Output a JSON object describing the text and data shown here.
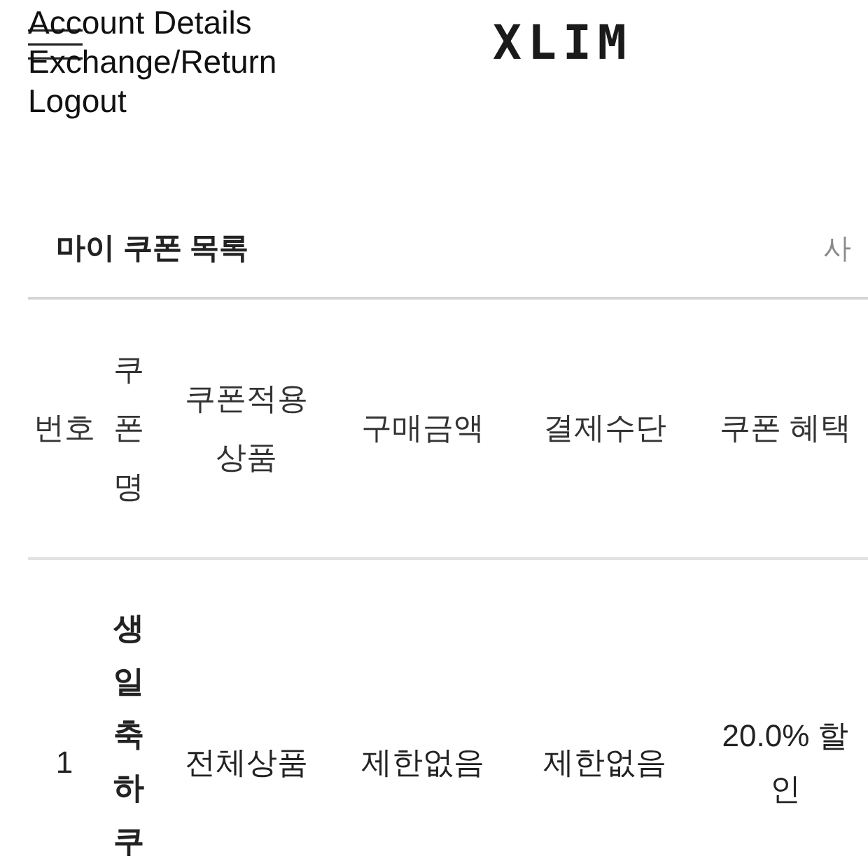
{
  "nav": {
    "links": [
      "Account Details",
      "Exchange/Return",
      "Logout"
    ]
  },
  "logo": {
    "text": "XLIM"
  },
  "coupons": {
    "title": "마이 쿠폰 목록",
    "side_text": "사",
    "table": {
      "columns": [
        "번호",
        "쿠폰명",
        "쿠폰적용상품",
        "구매금액",
        "결제수단",
        "쿠폰 혜택"
      ],
      "rows": [
        {
          "number": "1",
          "name": "생일축하쿠",
          "products": "전체상품",
          "purchase_amount": "제한없음",
          "payment_method": "제한없음",
          "benefit": "20.0% 할인"
        }
      ]
    }
  }
}
